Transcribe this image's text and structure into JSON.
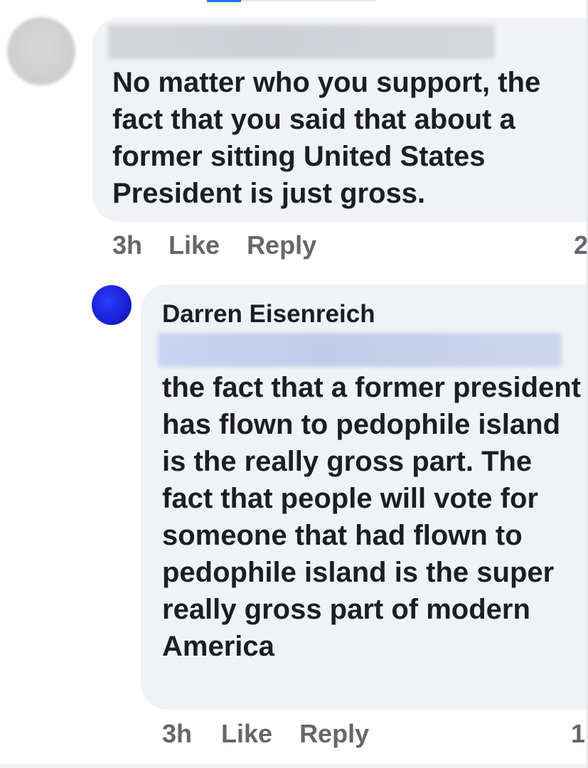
{
  "comment_1": {
    "text": "No matter who you support, the fact that you said that about a former sitting United States President is just gross.",
    "time": "3h",
    "like_label": "Like",
    "reply_label": "Reply",
    "reaction_count": "2"
  },
  "reply_1": {
    "author": "Darren Eisenreich",
    "text": "the fact that a former president has flown to pedophile island is the really gross part. The fact that people will vote for someone that had flown to pedophile island is the super really gross part of modern America",
    "time": "3h",
    "like_label": "Like",
    "reply_label": "Reply",
    "reaction_count": "1"
  },
  "colors": {
    "bubble_bg": "#f0f2f5",
    "text_primary": "#1c1e21",
    "text_secondary": "#65676b",
    "avatar_reply": "#1a22d6"
  }
}
